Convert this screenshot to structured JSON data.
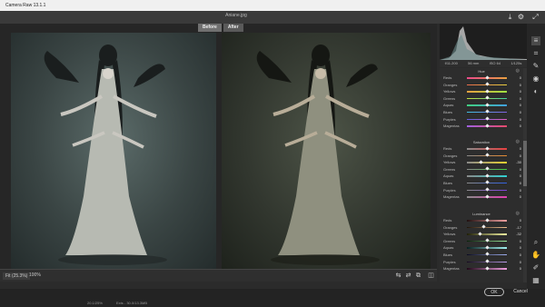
{
  "app": {
    "title": "Camera Raw 13.1.1",
    "filename": "Aniane.jpg"
  },
  "view_tabs": [
    {
      "label": "Before"
    },
    {
      "label": "After"
    }
  ],
  "bottom": {
    "fit_label": "Fit (25.3%)",
    "zoom_value": "100%"
  },
  "status": {
    "seg1": "20.1/25%",
    "seg2": "Exts - 30.0/13.3MB"
  },
  "readout": {
    "values": [
      "f/11.200",
      "56 mm",
      "ISO 64",
      "1/125s"
    ]
  },
  "histogram": {
    "colors": [
      "#bfbfbf",
      "#6a8a8a"
    ]
  },
  "hue": {
    "title": "Hue",
    "rows": [
      {
        "label": "Reds",
        "value": "0",
        "pos": 0.5,
        "c1": "#e84a8a",
        "c2": "#e8a040"
      },
      {
        "label": "Oranges",
        "value": "0",
        "pos": 0.5,
        "c1": "#e86a4a",
        "c2": "#e8d040"
      },
      {
        "label": "Yellows",
        "value": "0",
        "pos": 0.5,
        "c1": "#e8a040",
        "c2": "#a0e040"
      },
      {
        "label": "Greens",
        "value": "0",
        "pos": 0.5,
        "c1": "#c0e040",
        "c2": "#40d0a0"
      },
      {
        "label": "Aquas",
        "value": "0",
        "pos": 0.5,
        "c1": "#40d080",
        "c2": "#40a0e0"
      },
      {
        "label": "Blues",
        "value": "0",
        "pos": 0.5,
        "c1": "#40c0e0",
        "c2": "#8060e0"
      },
      {
        "label": "Purples",
        "value": "0",
        "pos": 0.5,
        "c1": "#6060e0",
        "c2": "#e060c0"
      },
      {
        "label": "Magentas",
        "value": "0",
        "pos": 0.5,
        "c1": "#a060e0",
        "c2": "#e84a6a"
      }
    ]
  },
  "saturation": {
    "title": "Saturation",
    "rows": [
      {
        "label": "Reds",
        "value": "0",
        "pos": 0.5,
        "c1": "#8a8a8a",
        "c2": "#e84040"
      },
      {
        "label": "Oranges",
        "value": "0",
        "pos": 0.5,
        "c1": "#8a8a8a",
        "c2": "#e88a30"
      },
      {
        "label": "Yellows",
        "value": "-30",
        "pos": 0.35,
        "c1": "#8a8a8a",
        "c2": "#e8d030"
      },
      {
        "label": "Greens",
        "value": "0",
        "pos": 0.5,
        "c1": "#8a8a8a",
        "c2": "#40d040"
      },
      {
        "label": "Aquas",
        "value": "0",
        "pos": 0.5,
        "c1": "#8a8a8a",
        "c2": "#30d0d0"
      },
      {
        "label": "Blues",
        "value": "0",
        "pos": 0.5,
        "c1": "#8a8a8a",
        "c2": "#3060e0"
      },
      {
        "label": "Purples",
        "value": "0",
        "pos": 0.5,
        "c1": "#8a8a8a",
        "c2": "#8040e0"
      },
      {
        "label": "Magentas",
        "value": "0",
        "pos": 0.5,
        "c1": "#8a8a8a",
        "c2": "#e040b0"
      }
    ]
  },
  "luminance": {
    "title": "Luminance",
    "rows": [
      {
        "label": "Reds",
        "value": "0",
        "pos": 0.5,
        "c1": "#201010",
        "c2": "#f0a0a0"
      },
      {
        "label": "Oranges",
        "value": "-17",
        "pos": 0.42,
        "c1": "#201408",
        "c2": "#f0c090"
      },
      {
        "label": "Yellows",
        "value": "-32",
        "pos": 0.34,
        "c1": "#202008",
        "c2": "#f0f0a0"
      },
      {
        "label": "Greens",
        "value": "0",
        "pos": 0.5,
        "c1": "#082008",
        "c2": "#a0f0a0"
      },
      {
        "label": "Aquas",
        "value": "0",
        "pos": 0.5,
        "c1": "#082020",
        "c2": "#a0f0f0"
      },
      {
        "label": "Blues",
        "value": "0",
        "pos": 0.5,
        "c1": "#080820",
        "c2": "#a0b0f0"
      },
      {
        "label": "Purples",
        "value": "0",
        "pos": 0.5,
        "c1": "#140820",
        "c2": "#c0a0f0"
      },
      {
        "label": "Magentas",
        "value": "0",
        "pos": 0.5,
        "c1": "#200818",
        "c2": "#f0a0e0"
      }
    ]
  },
  "buttons": {
    "ok": "OK",
    "cancel": "Cancel"
  },
  "tools": [
    "open-in-new-icon",
    "edit-sliders-icon",
    "crop-icon",
    "spot-heal-icon",
    "redeye-icon",
    "mask-icon",
    "zoom-icon",
    "hand-icon",
    "eyedropper-icon",
    "grid-icon",
    "more-icon"
  ]
}
